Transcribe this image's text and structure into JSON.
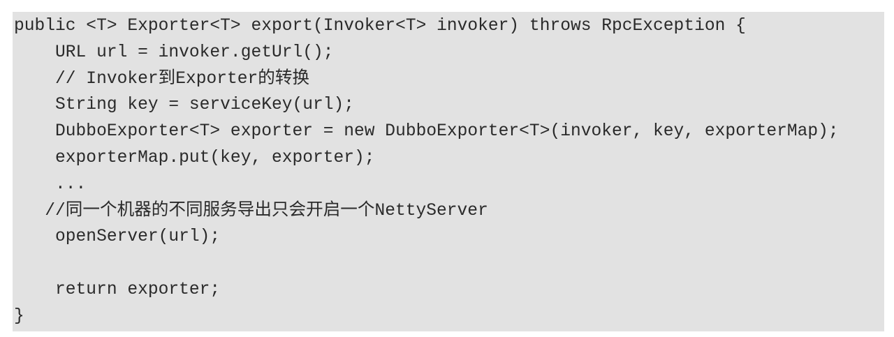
{
  "code": {
    "lines": [
      "public <T> Exporter<T> export(Invoker<T> invoker) throws RpcException {",
      "    URL url = invoker.getUrl();",
      "    // Invoker到Exporter的转换",
      "    String key = serviceKey(url);",
      "    DubboExporter<T> exporter = new DubboExporter<T>(invoker, key, exporterMap);",
      "    exporterMap.put(key, exporter);",
      "    ...",
      "   //同一个机器的不同服务导出只会开启一个NettyServer",
      "    openServer(url);",
      "",
      "    return exporter;",
      "}"
    ]
  }
}
